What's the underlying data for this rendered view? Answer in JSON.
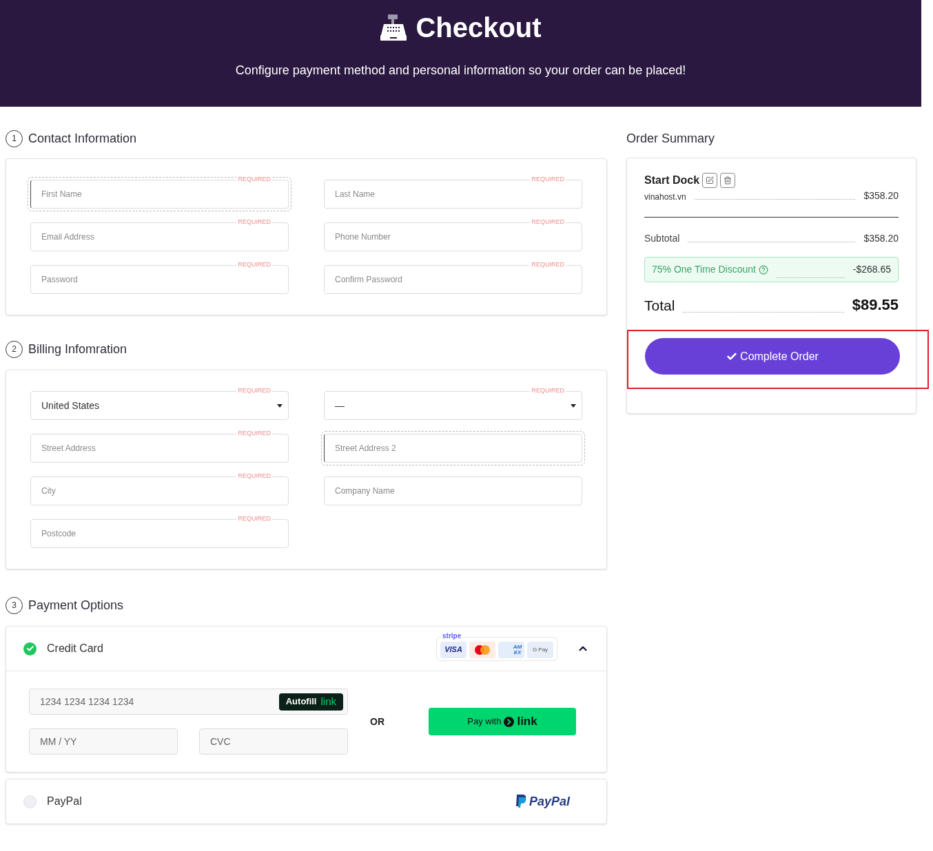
{
  "header": {
    "title": "Checkout",
    "subtitle": "Configure payment method and personal information so your order can be placed!"
  },
  "contact": {
    "number": "1",
    "title": "Contact Information",
    "fields": [
      {
        "kind": "text",
        "placeholder": "First Name",
        "badge": "REQUIRED",
        "focused": true
      },
      {
        "kind": "text",
        "placeholder": "Last Name",
        "badge": "REQUIRED",
        "focused": false
      },
      {
        "kind": "text",
        "placeholder": "Email Address",
        "badge": "REQUIRED",
        "focused": false
      },
      {
        "kind": "text",
        "placeholder": "Phone Number",
        "badge": "REQUIRED",
        "focused": false
      },
      {
        "kind": "text",
        "placeholder": "Password",
        "badge": "REQUIRED",
        "focused": false
      },
      {
        "kind": "text",
        "placeholder": "Confirm Password",
        "badge": "REQUIRED",
        "focused": false
      }
    ]
  },
  "billing": {
    "number": "2",
    "title": "Billing Infomration",
    "fields": [
      {
        "kind": "select",
        "value": "United States",
        "badge": "REQUIRED",
        "focused": false
      },
      {
        "kind": "select",
        "value": "—",
        "badge": "REQUIRED",
        "focused": false
      },
      {
        "kind": "text",
        "placeholder": "Street Address",
        "badge": "REQUIRED",
        "focused": false
      },
      {
        "kind": "text",
        "placeholder": "Street Address 2",
        "focused": true
      },
      {
        "kind": "text",
        "placeholder": "City",
        "badge": "REQUIRED",
        "focused": false
      },
      {
        "kind": "text",
        "placeholder": "Company Name",
        "focused": false
      },
      {
        "kind": "text",
        "placeholder": "Postcode",
        "badge": "REQUIRED",
        "focused": false
      }
    ]
  },
  "payment": {
    "number": "3",
    "title": "Payment Options",
    "options": [
      {
        "kind": "card",
        "label": "Credit Card",
        "selected": true,
        "expanded": true
      },
      {
        "kind": "paypal",
        "label": "PayPal",
        "selected": false,
        "logo": "PayPal"
      }
    ],
    "stripe": {
      "caption": "stripe",
      "logos": [
        {
          "kind": "visa",
          "label": "VISA"
        },
        {
          "kind": "mastercard"
        },
        {
          "kind": "amex",
          "label": "AM EX"
        },
        {
          "kind": "gpay",
          "label": "G Pay"
        }
      ]
    },
    "card_number": {
      "placeholder": "1234 1234 1234 1234"
    },
    "autofill": {
      "label": "Autofill",
      "brand": "link"
    },
    "expiry": {
      "placeholder": "MM / YY"
    },
    "cvc": {
      "placeholder": "CVC"
    },
    "separator": "OR",
    "pay_link": {
      "label": "Pay with",
      "brand": "link"
    }
  },
  "summary": {
    "title": "Order Summary",
    "item": {
      "name": "Start Dock",
      "domain": "vinahost.vn",
      "price": "$358.20"
    },
    "subtotal": {
      "label": "Subtotal",
      "value": "$358.20"
    },
    "discount": {
      "label": "75% One Time Discount",
      "value": "-$268.65"
    },
    "total": {
      "label": "Total",
      "value": "$89.55"
    },
    "order_button": {
      "label": "Complete Order",
      "highlighted": true
    }
  }
}
